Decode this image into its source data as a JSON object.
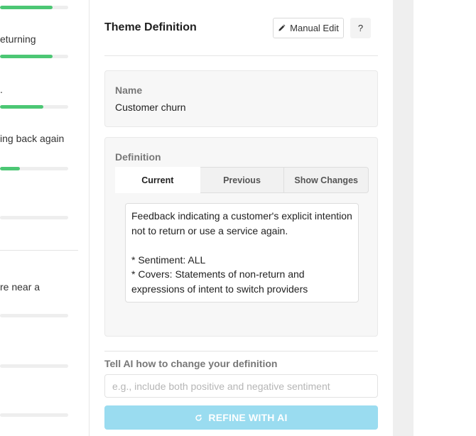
{
  "left_list": {
    "items": [
      {
        "text": "",
        "fill": 0.77
      },
      {
        "text": "eturning",
        "fill": 0.77
      },
      {
        "text": ".",
        "fill": 0.64
      },
      {
        "text": "ing back again",
        "fill": 0.29
      },
      {
        "text": "",
        "fill": 0.0
      },
      {
        "text": "re near a",
        "fill": 0.0
      },
      {
        "text": "",
        "fill": 0.0
      },
      {
        "text": "",
        "fill": 0.0
      }
    ]
  },
  "header": {
    "title": "Theme Definition",
    "manual_edit_label": "Manual Edit",
    "help_label": "?"
  },
  "name_card": {
    "label": "Name",
    "value": "Customer churn"
  },
  "definition_card": {
    "label": "Definition",
    "tabs": [
      "Current",
      "Previous",
      "Show Changes"
    ],
    "active_tab": "Current",
    "lines": [
      "Feedback indicating a customer's explicit intention",
      "not to return or use a service again.",
      "",
      "* Sentiment: ALL",
      "* Covers: Statements of non-return and",
      "expressions of intent to switch providers"
    ]
  },
  "refine": {
    "label": "Tell AI how to change your definition",
    "placeholder": "e.g., include both positive and negative sentiment",
    "value": "",
    "button_label": "REFINE WITH AI"
  },
  "colors": {
    "progress_fill": "#4cc774",
    "refine_button": "#9adcf0"
  }
}
